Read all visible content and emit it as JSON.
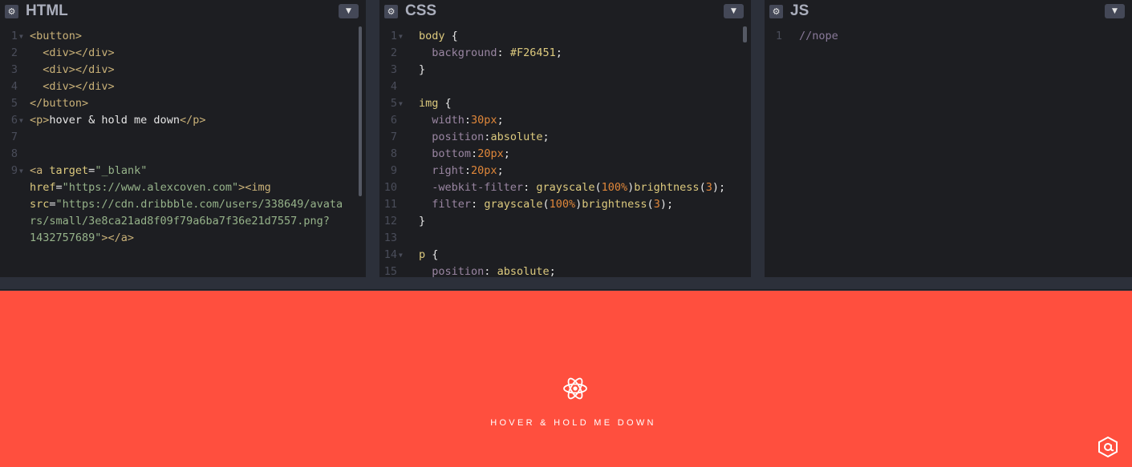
{
  "panels": {
    "html": {
      "title": "HTML"
    },
    "css": {
      "title": "CSS"
    },
    "js": {
      "title": "JS"
    }
  },
  "icons": {
    "settings": "gear-icon",
    "collapse": "chevron-down-icon",
    "preview_icon": "atom-icon",
    "logo": "at-sign-logo"
  },
  "html_lines": [
    {
      "n": "1",
      "fold": true,
      "parts": [
        [
          "tag",
          "<button>"
        ]
      ]
    },
    {
      "n": "2",
      "parts": [
        [
          "plain",
          "  "
        ],
        [
          "tag",
          "<div></div>"
        ]
      ]
    },
    {
      "n": "3",
      "parts": [
        [
          "plain",
          "  "
        ],
        [
          "tag",
          "<div></div>"
        ]
      ]
    },
    {
      "n": "4",
      "parts": [
        [
          "plain",
          "  "
        ],
        [
          "tag",
          "<div></div>"
        ]
      ]
    },
    {
      "n": "5",
      "parts": [
        [
          "tag",
          "</button>"
        ]
      ]
    },
    {
      "n": "6",
      "fold": true,
      "parts": [
        [
          "tag",
          "<p>"
        ],
        [
          "plain",
          "hover & hold me down"
        ],
        [
          "tag",
          "</p>"
        ]
      ]
    },
    {
      "n": "7",
      "parts": []
    },
    {
      "n": "8",
      "parts": []
    },
    {
      "n": "9",
      "fold": true,
      "parts": [
        [
          "tag",
          "<a "
        ],
        [
          "attr",
          "target"
        ],
        [
          "plain",
          "="
        ],
        [
          "str",
          "\"_blank\""
        ]
      ]
    },
    {
      "n": "",
      "parts": [
        [
          "attr",
          "href"
        ],
        [
          "plain",
          "="
        ],
        [
          "str",
          "\"https://www.alexcoven.com\""
        ],
        [
          "tag",
          "><img"
        ]
      ]
    },
    {
      "n": "",
      "parts": [
        [
          "attr",
          "src"
        ],
        [
          "plain",
          "="
        ],
        [
          "str",
          "\"https://cdn.dribbble.com/users/338649/avata"
        ]
      ]
    },
    {
      "n": "",
      "parts": [
        [
          "str",
          "rs/small/3e8ca21ad8f09f79a6ba7f36e21d7557.png?"
        ]
      ]
    },
    {
      "n": "",
      "parts": [
        [
          "str",
          "1432757689\""
        ],
        [
          "tag",
          "></a>"
        ]
      ]
    }
  ],
  "css_lines": [
    {
      "n": "1",
      "fold": true,
      "parts": [
        [
          "sel",
          "body"
        ],
        [
          "plain",
          " {"
        ]
      ]
    },
    {
      "n": "2",
      "parts": [
        [
          "plain",
          "  "
        ],
        [
          "prop",
          "background"
        ],
        [
          "plain",
          ": "
        ],
        [
          "val",
          "#F26451"
        ],
        [
          "plain",
          ";"
        ]
      ]
    },
    {
      "n": "3",
      "parts": [
        [
          "plain",
          "}"
        ]
      ]
    },
    {
      "n": "4",
      "parts": []
    },
    {
      "n": "5",
      "fold": true,
      "parts": [
        [
          "sel",
          "img"
        ],
        [
          "plain",
          " {"
        ]
      ]
    },
    {
      "n": "6",
      "parts": [
        [
          "plain",
          "  "
        ],
        [
          "prop",
          "width"
        ],
        [
          "plain",
          ":"
        ],
        [
          "num",
          "30px"
        ],
        [
          "plain",
          ";"
        ]
      ]
    },
    {
      "n": "7",
      "parts": [
        [
          "plain",
          "  "
        ],
        [
          "prop",
          "position"
        ],
        [
          "plain",
          ":"
        ],
        [
          "val",
          "absolute"
        ],
        [
          "plain",
          ";"
        ]
      ]
    },
    {
      "n": "8",
      "parts": [
        [
          "plain",
          "  "
        ],
        [
          "prop",
          "bottom"
        ],
        [
          "plain",
          ":"
        ],
        [
          "num",
          "20px"
        ],
        [
          "plain",
          ";"
        ]
      ]
    },
    {
      "n": "9",
      "parts": [
        [
          "plain",
          "  "
        ],
        [
          "prop",
          "right"
        ],
        [
          "plain",
          ":"
        ],
        [
          "num",
          "20px"
        ],
        [
          "plain",
          ";"
        ]
      ]
    },
    {
      "n": "10",
      "parts": [
        [
          "plain",
          "  "
        ],
        [
          "prop",
          "-webkit-filter"
        ],
        [
          "plain",
          ": "
        ],
        [
          "fn",
          "grayscale"
        ],
        [
          "plain",
          "("
        ],
        [
          "num",
          "100%"
        ],
        [
          "plain",
          ")"
        ],
        [
          "fn",
          "brightness"
        ],
        [
          "plain",
          "("
        ],
        [
          "num",
          "3"
        ],
        [
          "plain",
          ");"
        ]
      ]
    },
    {
      "n": "11",
      "parts": [
        [
          "plain",
          "  "
        ],
        [
          "prop",
          "filter"
        ],
        [
          "plain",
          ": "
        ],
        [
          "fn",
          "grayscale"
        ],
        [
          "plain",
          "("
        ],
        [
          "num",
          "100%"
        ],
        [
          "plain",
          ")"
        ],
        [
          "fn",
          "brightness"
        ],
        [
          "plain",
          "("
        ],
        [
          "num",
          "3"
        ],
        [
          "plain",
          ");"
        ]
      ]
    },
    {
      "n": "12",
      "parts": [
        [
          "plain",
          "}"
        ]
      ]
    },
    {
      "n": "13",
      "parts": []
    },
    {
      "n": "14",
      "fold": true,
      "parts": [
        [
          "sel",
          "p"
        ],
        [
          "plain",
          " {"
        ]
      ]
    },
    {
      "n": "15",
      "parts": [
        [
          "plain",
          "  "
        ],
        [
          "prop",
          "position"
        ],
        [
          "plain",
          ": "
        ],
        [
          "val",
          "absolute"
        ],
        [
          "plain",
          ";"
        ]
      ]
    }
  ],
  "js_lines": [
    {
      "n": "1",
      "parts": [
        [
          "cmt",
          "//nope"
        ]
      ]
    }
  ],
  "preview": {
    "caption": "HOVER & HOLD ME DOWN",
    "background": "#ff4f3e"
  }
}
